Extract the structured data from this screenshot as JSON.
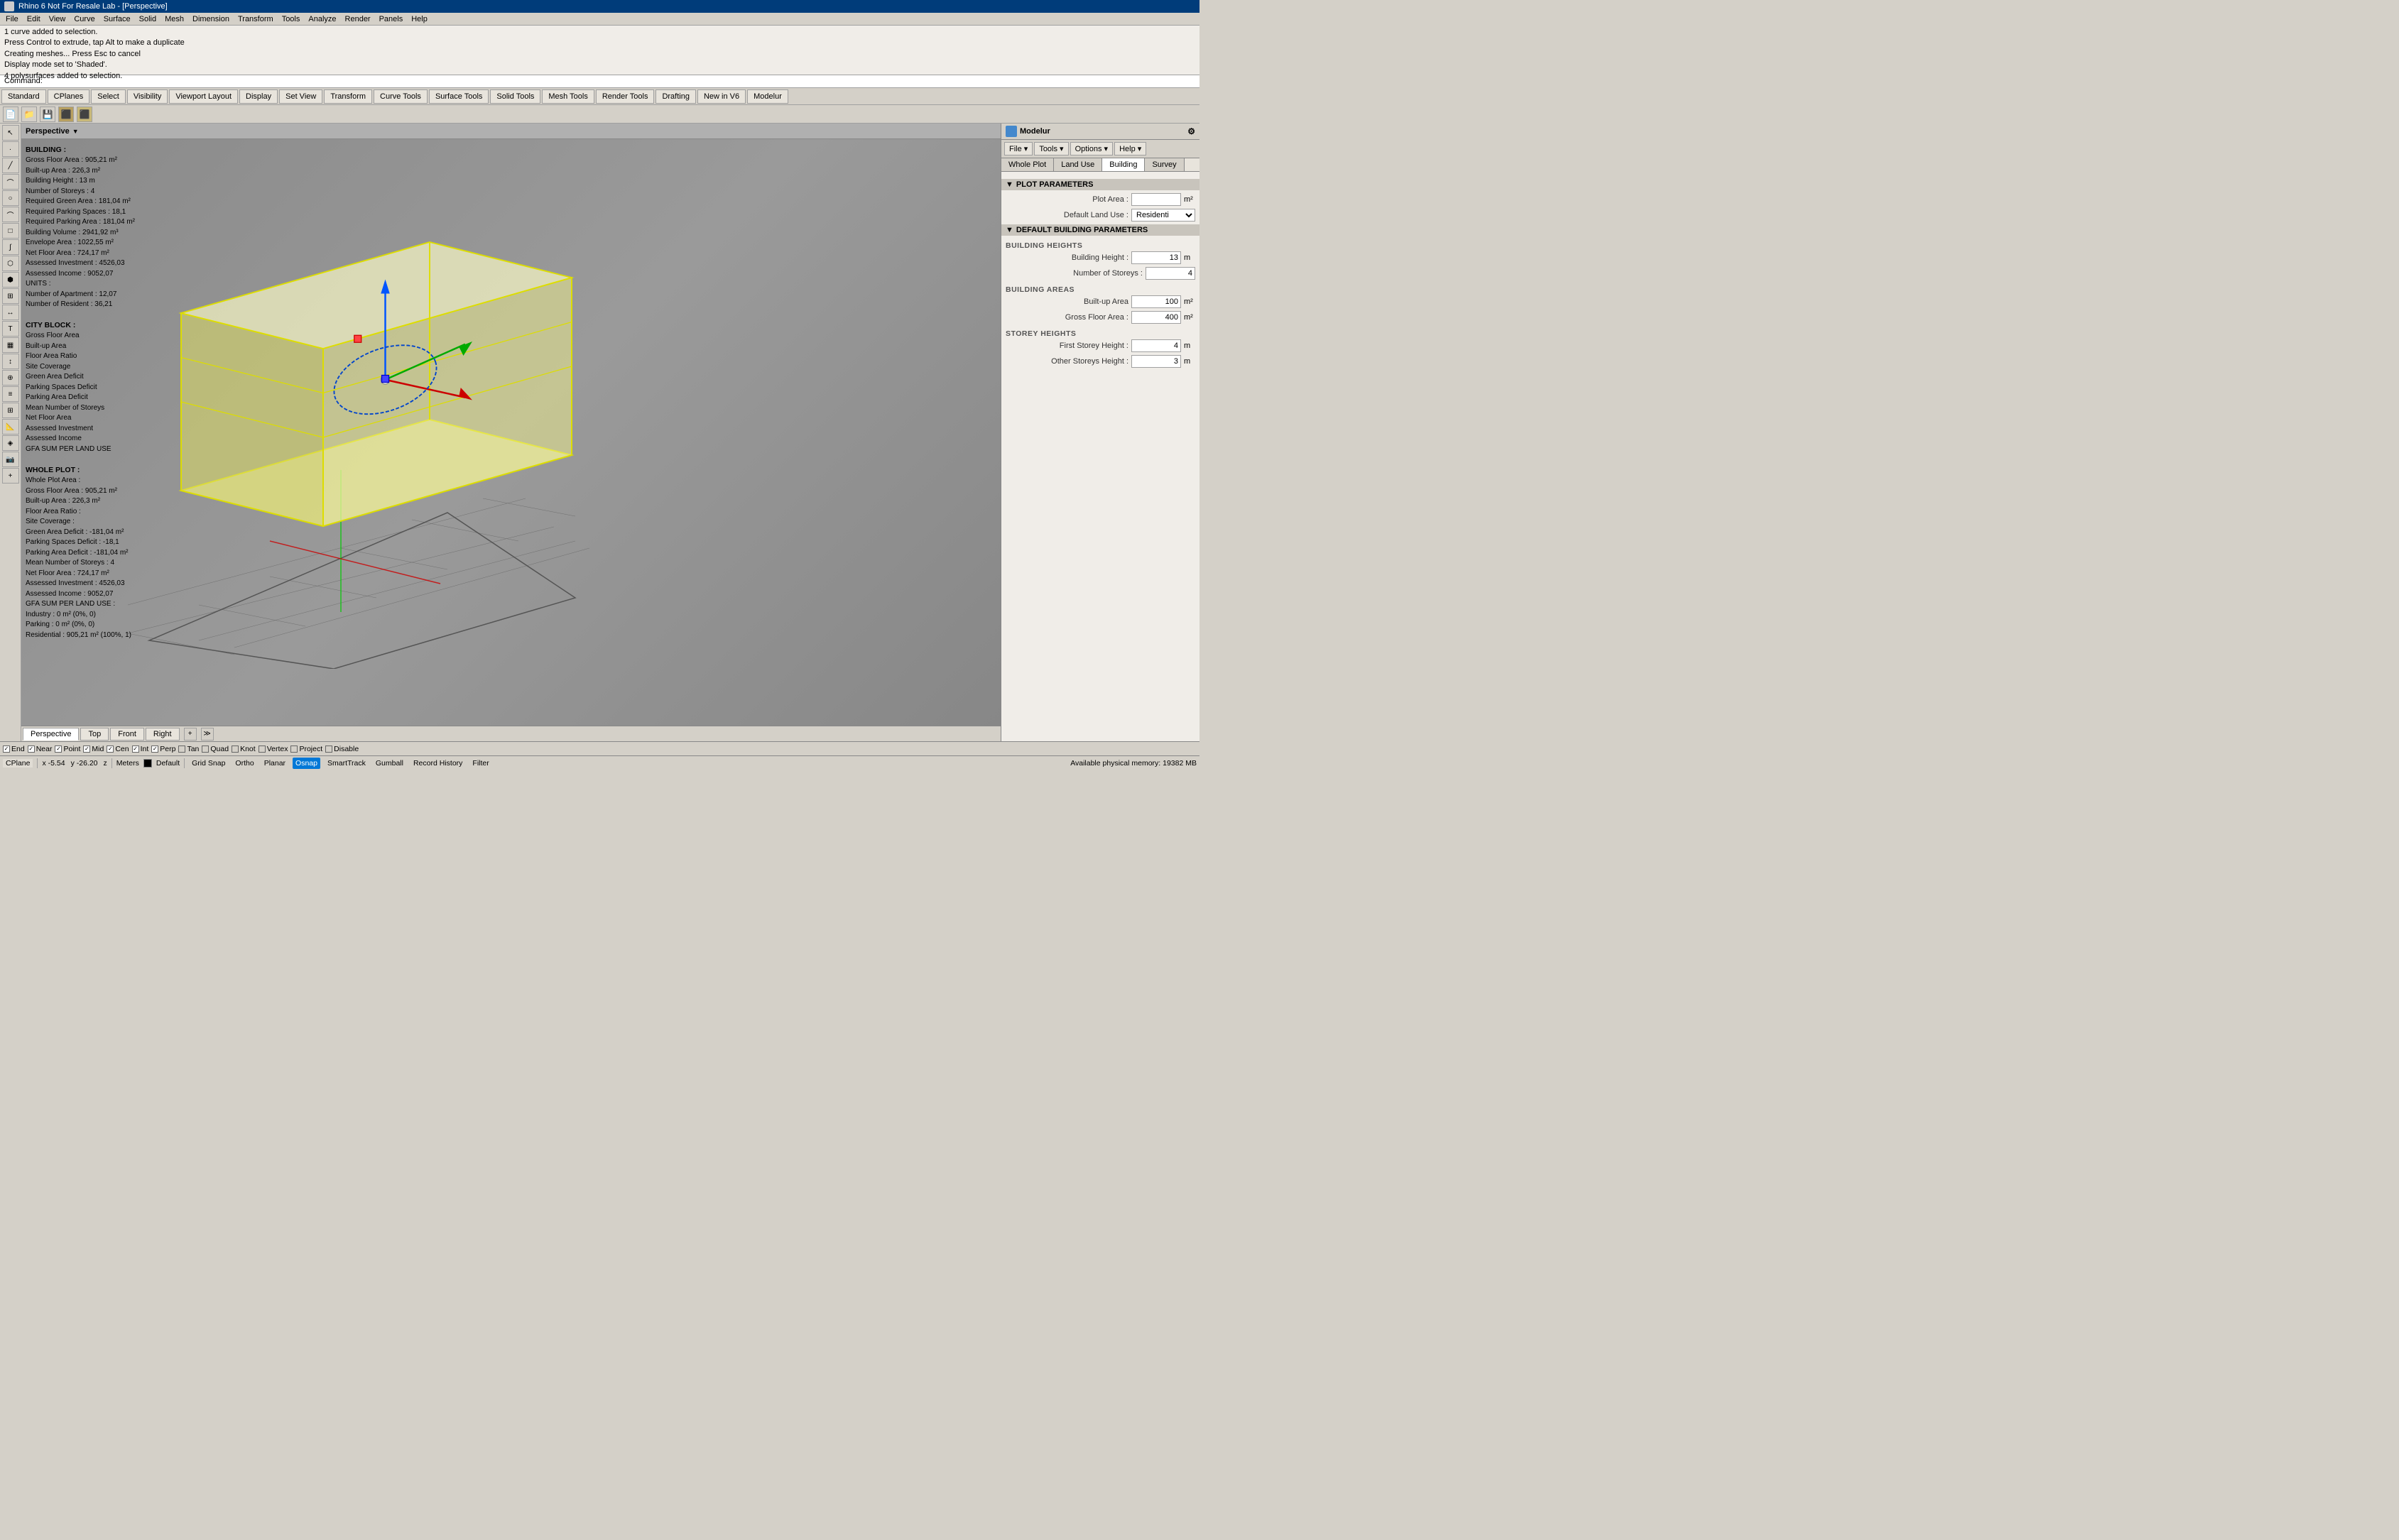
{
  "titleBar": {
    "title": "Rhino 6 Not For Resale Lab - [Perspective]",
    "icon": "rhino-icon"
  },
  "menuBar": {
    "items": [
      "File",
      "Edit",
      "View",
      "Curve",
      "Surface",
      "Solid",
      "Mesh",
      "Dimension",
      "Transform",
      "Tools",
      "Analyze",
      "Render",
      "Panels",
      "Help"
    ]
  },
  "commandOutput": {
    "lines": [
      "1 curve added to selection.",
      "Press Control to extrude, tap Alt to make a duplicate",
      "Creating meshes... Press Esc to cancel",
      "Display mode set to 'Shaded'.",
      "4 polysurfaces added to selection."
    ],
    "commandLabel": "Command:"
  },
  "toolbarTabs": {
    "items": [
      "Standard",
      "CPlanes",
      "Select",
      "Visibility",
      "Viewport Layout",
      "Display",
      "Set View",
      "Transform",
      "Curve Tools",
      "Surface Tools",
      "Solid Tools",
      "Mesh Tools",
      "Render Tools",
      "Drafting",
      "New in V6",
      "Modelur"
    ]
  },
  "viewportHeader": {
    "label": "Perspective",
    "dropdownIcon": "chevron-down-icon"
  },
  "viewportTabs": {
    "tabs": [
      "Perspective",
      "Top",
      "Front",
      "Right"
    ],
    "activeTab": "Perspective"
  },
  "infoPanel": {
    "buildingSection": "BUILDING :",
    "buildingFields": [
      "Gross Floor Area : 905,21 m²",
      "Built-up Area : 226,3 m²",
      "Building Height : 13 m",
      "Number of Storeys : 4",
      "Required Green Area : 181,04 m²",
      "Required Parking Spaces : 18,1",
      "Required Parking Area : 181,04 m²",
      "Building Volume : 2941,92 m³",
      "Envelope Area : 1022,55 m²",
      "Net Floor Area : 724,17 m²",
      "Assessed Investment : 4526,03",
      "Assessed Income : 9052,07",
      "UNITS :",
      "Number of Apartment : 12,07",
      "Number of Resident : 36,21"
    ],
    "cityBlockSection": "CITY BLOCK :",
    "cityBlockFields": [
      "Gross Floor Area",
      "Built-up Area",
      "Floor Area Ratio",
      "Site Coverage",
      "Green Area Deficit",
      "Parking Spaces Deficit",
      "Parking Area Deficit",
      "Mean Number of Storeys",
      "Net Floor Area",
      "Assessed Investment",
      "Assessed Income",
      "GFA SUM PER LAND USE"
    ],
    "wholePlotSection": "WHOLE PLOT :",
    "wholePlotFields": [
      "Whole Plot Area :",
      "Gross Floor Area : 905,21 m²",
      "Built-up Area : 226,3 m²",
      "Floor Area Ratio :",
      "Site Coverage :",
      "Green Area Deficit : -181,04 m²",
      "Parking Spaces Deficit : -18,1",
      "Parking Area Deficit : -181,04 m²",
      "Mean Number of Storeys : 4",
      "Net Floor Area : 724,17 m²",
      "Assessed Investment : 4526,03",
      "Assessed Income : 9052,07",
      "GFA SUM PER LAND USE :",
      "Industry : 0 m² (0%, 0)",
      "Parking : 0 m² (0%, 0)",
      "Residential : 905,21 m² (100%, 1)"
    ]
  },
  "rightPanel": {
    "title": "Modelur",
    "titleIcon": "modelur-icon",
    "settingsIcon": "gear-icon",
    "toolbar": {
      "fileBtn": "File ▾",
      "toolsBtn": "Tools ▾",
      "optionsBtn": "Options ▾",
      "helpBtn": "Help ▾"
    },
    "tabs": [
      "Whole Plot",
      "Land Use",
      "Building",
      "Survey"
    ],
    "activeTab": "Building",
    "sections": {
      "plotParameters": {
        "header": "PLOT PARAMETERS",
        "plotAreaLabel": "Plot Area :",
        "plotAreaValue": "",
        "plotAreaUnit": "m²",
        "defaultLandUseLabel": "Default Land Use :",
        "defaultLandUseValue": "Residenti"
      },
      "defaultBuildingParameters": {
        "header": "DEFAULT BUILDING PARAMETERS",
        "buildingHeights": {
          "subHeader": "BUILDING HEIGHTS",
          "buildingHeightLabel": "Building Height :",
          "buildingHeightValue": "13",
          "buildingHeightUnit": "m",
          "numStoreysLabel": "Number of Storeys :",
          "numStoreysValue": "4"
        },
        "buildingAreas": {
          "subHeader": "BUILDING AREAS",
          "builtUpAreaLabel": "Built-up Area",
          "builtUpAreaValue": "100",
          "builtUpAreaUnit": "m²",
          "grossFloorAreaLabel": "Gross Floor Area :",
          "grossFloorAreaValue": "400",
          "grossFloorAreaUnit": "m²"
        },
        "storeyHeights": {
          "subHeader": "STOREY HEIGHTS",
          "firstStoreyLabel": "First Storey Height :",
          "firstStoreyValue": "4",
          "firstStoreyUnit": "m",
          "otherStoreysLabel": "Other Storeys Height :",
          "otherStoreysValue": "3",
          "otherStoreysUnit": "m"
        }
      }
    }
  },
  "osnapBar": {
    "checkboxes": [
      {
        "label": "End",
        "checked": true
      },
      {
        "label": "Near",
        "checked": true
      },
      {
        "label": "Point",
        "checked": true
      },
      {
        "label": "Mid",
        "checked": true
      },
      {
        "label": "Cen",
        "checked": true
      },
      {
        "label": "Int",
        "checked": true
      },
      {
        "label": "Perp",
        "checked": true
      },
      {
        "label": "Tan",
        "checked": false
      },
      {
        "label": "Quad",
        "checked": false
      },
      {
        "label": "Knot",
        "checked": false
      },
      {
        "label": "Vertex",
        "checked": false
      },
      {
        "label": "Project",
        "checked": false
      },
      {
        "label": "Disable",
        "checked": false
      }
    ]
  },
  "statusBar": {
    "cplane": "CPlane",
    "x": "x -5.54",
    "y": "y -26.20",
    "z": "z",
    "units": "Meters",
    "colorSwatch": "#000000",
    "layer": "Default",
    "gridSnap": "Grid Snap",
    "ortho": "Ortho",
    "planar": "Planar",
    "osnap": "Osnap",
    "smarttrack": "SmartTrack",
    "gumball": "Gumball",
    "recordHistory": "Record History",
    "filter": "Filter",
    "memory": "Available physical memory: 19382 MB"
  }
}
